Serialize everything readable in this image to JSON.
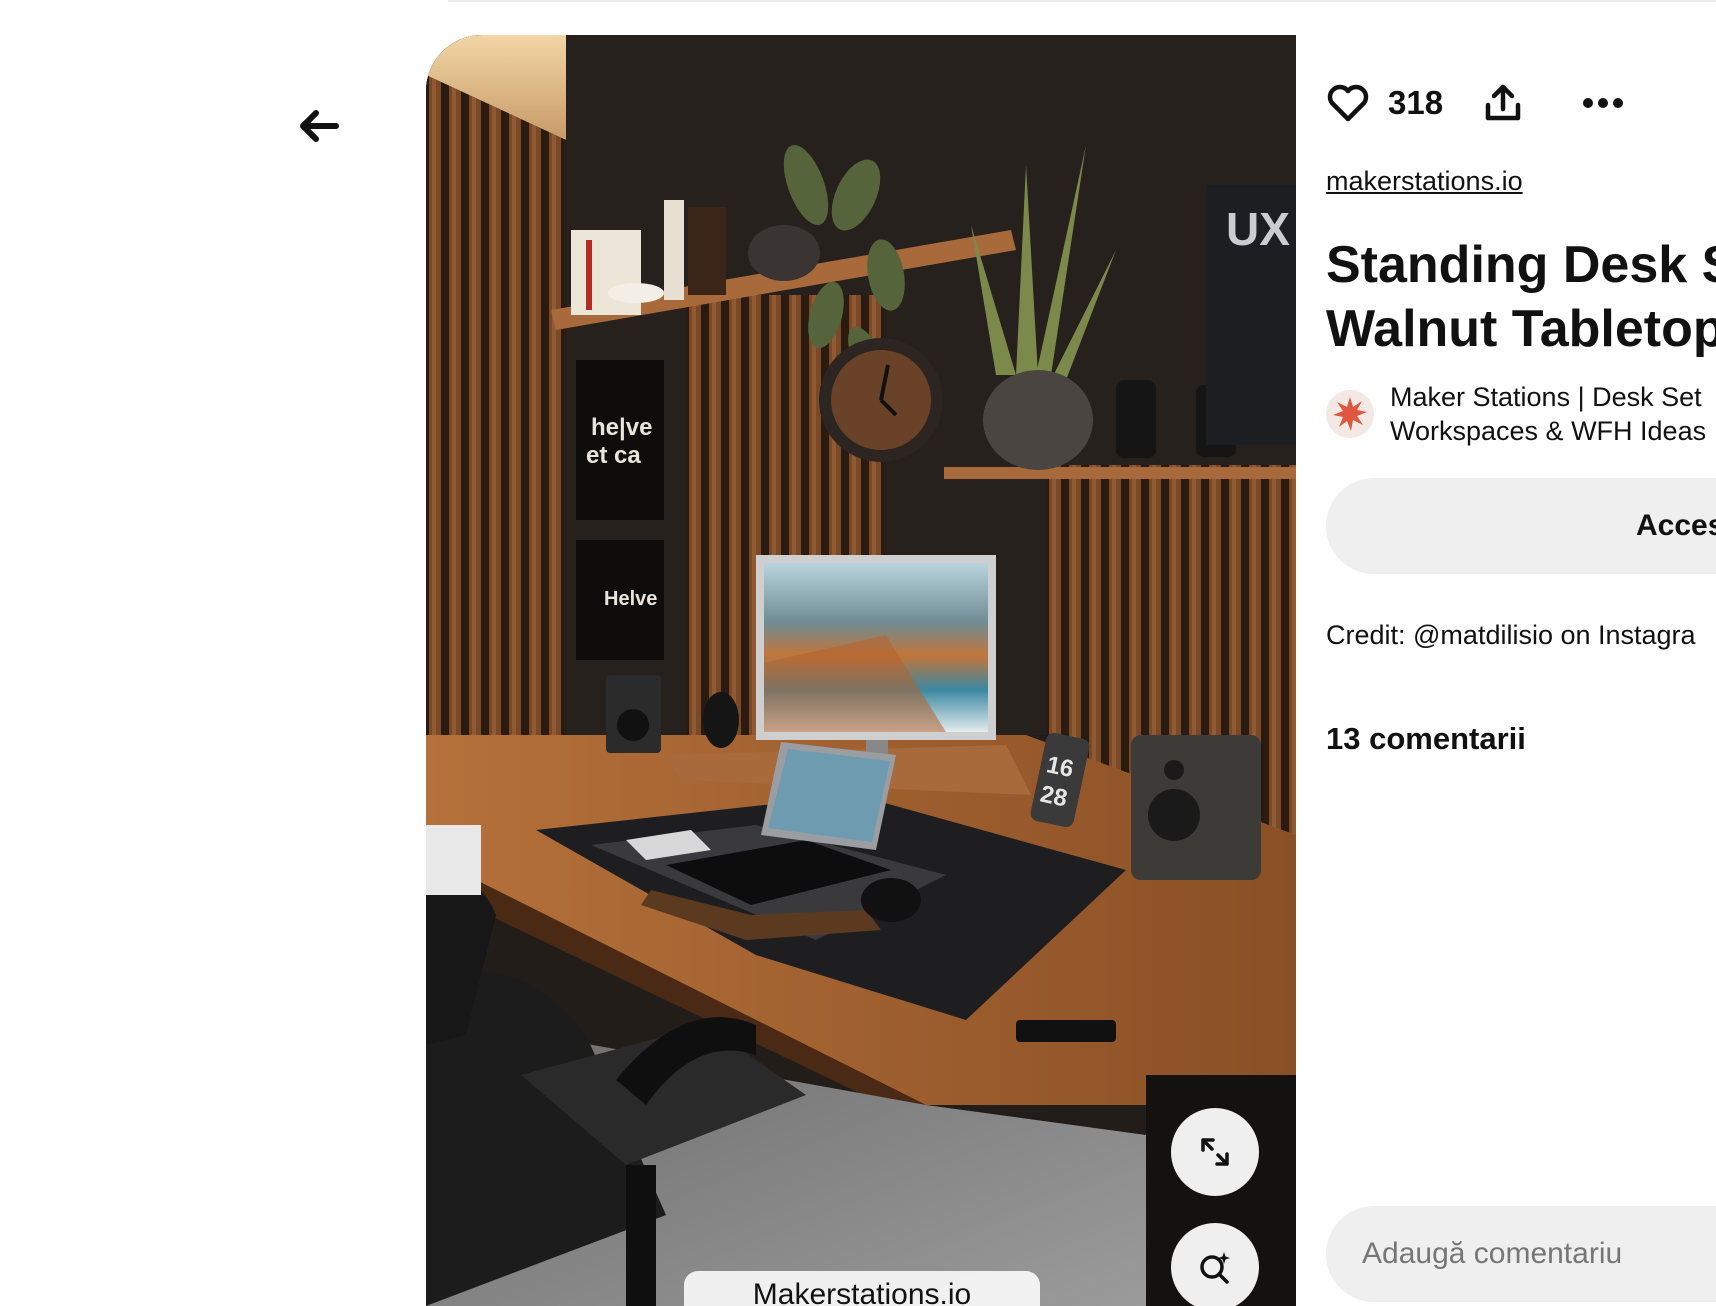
{
  "icons": {
    "back": "arrow-left-icon",
    "like": "heart-icon",
    "share": "share-icon",
    "more": "ellipsis-icon",
    "expand": "expand-icon",
    "visual_search": "visual-search-icon",
    "creator_avatar": "starburst-icon"
  },
  "colors": {
    "brand_avatar": "#e0563f",
    "button_bg": "#efefef",
    "text": "#111111",
    "placeholder": "#767676"
  },
  "pin": {
    "image_caption": "Makerstations.io",
    "image_text": {
      "poster_1": [
        "he|ve",
        "et ca"
      ],
      "poster_2": "Helve",
      "wall_sign": "UX",
      "phone_clock": [
        "16",
        "28"
      ]
    }
  },
  "sidebar": {
    "like_count": "318",
    "source_link": "makerstations.io",
    "title_line1": "Standing Desk S",
    "title_line2": "Walnut Tabletop",
    "creator_line1": "Maker Stations | Desk Set",
    "creator_line2": "Workspaces & WFH Ideas",
    "access_button": "Acces",
    "credit": "Credit: @matdilisio on Instagra",
    "comments_heading": "13 comentarii",
    "comment_placeholder": "Adaugă comentariu"
  }
}
